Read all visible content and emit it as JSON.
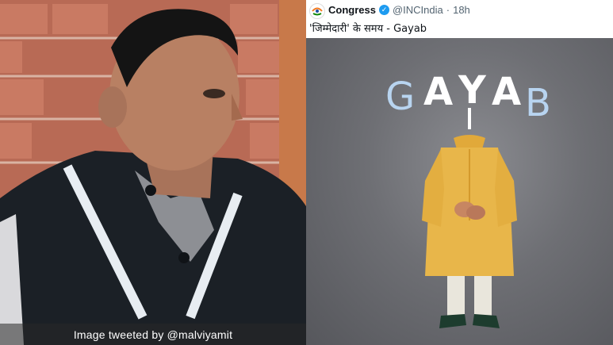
{
  "photo": {
    "caption": "Image tweeted by @malviyamit"
  },
  "tweet": {
    "account_name": "Congress",
    "handle": "@INCIndia",
    "separator": "·",
    "time": "18h",
    "text": "'जिम्मेदारी' के समय - Gayab",
    "verified_icon": "verified-badge-icon",
    "colors": {
      "verified": "#1d9bf0",
      "handle": "#536471"
    }
  },
  "poster": {
    "headline_letters": [
      "G",
      "A",
      "Y",
      "A",
      "B"
    ],
    "colors": {
      "light_blue": "#b8d4f0",
      "white": "#ffffff",
      "outfit": "#e8b64a",
      "background": "#6e6f74"
    }
  }
}
